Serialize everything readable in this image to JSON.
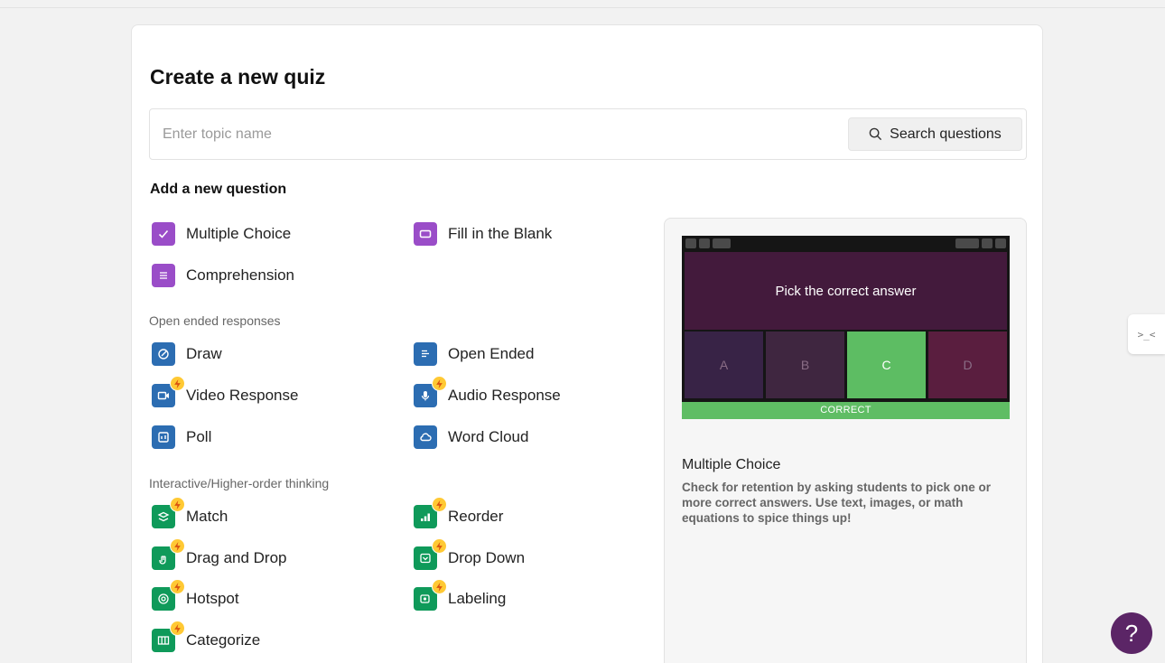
{
  "page": {
    "title": "Create a new quiz"
  },
  "search": {
    "placeholder": "Enter topic name",
    "button_label": "Search questions"
  },
  "section": {
    "heading": "Add a new question"
  },
  "basic_questions": [
    {
      "label": "Multiple Choice",
      "icon": "check-icon",
      "color": "#9a4dc8"
    },
    {
      "label": "Fill in the Blank",
      "icon": "blank-box-icon",
      "color": "#9a4dc8"
    },
    {
      "label": "Comprehension",
      "icon": "lines-icon",
      "color": "#9a4dc8"
    }
  ],
  "open_ended": {
    "label": "Open ended responses",
    "items": [
      {
        "label": "Draw",
        "icon": "draw-icon",
        "color": "#2c6db2",
        "premium": false
      },
      {
        "label": "Open Ended",
        "icon": "text-lines-icon",
        "color": "#2c6db2",
        "premium": false
      },
      {
        "label": "Video Response",
        "icon": "video-icon",
        "color": "#2c6db2",
        "premium": true
      },
      {
        "label": "Audio Response",
        "icon": "microphone-icon",
        "color": "#2c6db2",
        "premium": true
      },
      {
        "label": "Poll",
        "icon": "poll-icon",
        "color": "#2c6db2",
        "premium": false
      },
      {
        "label": "Word Cloud",
        "icon": "cloud-icon",
        "color": "#2c6db2",
        "premium": false
      }
    ]
  },
  "interactive": {
    "label": "Interactive/Higher-order thinking",
    "items": [
      {
        "label": "Match",
        "icon": "match-icon",
        "color": "#0f9a5a",
        "premium": true
      },
      {
        "label": "Reorder",
        "icon": "reorder-icon",
        "color": "#0f9a5a",
        "premium": true
      },
      {
        "label": "Drag and Drop",
        "icon": "drag-icon",
        "color": "#0f9a5a",
        "premium": true
      },
      {
        "label": "Drop Down",
        "icon": "dropdown-icon",
        "color": "#0f9a5a",
        "premium": true
      },
      {
        "label": "Hotspot",
        "icon": "hotspot-icon",
        "color": "#0f9a5a",
        "premium": true
      },
      {
        "label": "Labeling",
        "icon": "labeling-icon",
        "color": "#0f9a5a",
        "premium": true
      },
      {
        "label": "Categorize",
        "icon": "categorize-icon",
        "color": "#0f9a5a",
        "premium": true
      }
    ]
  },
  "preview": {
    "question_text": "Pick the correct answer",
    "options": [
      "A",
      "B",
      "C",
      "D"
    ],
    "correct_option": "C",
    "result_label": "CORRECT",
    "title": "Multiple Choice",
    "description": "Check for retention by asking students to pick one or more correct answers. Use text, images, or math equations to spice things up!"
  },
  "side_tab": {
    "label": ">_<"
  },
  "help": {
    "label": "?"
  }
}
